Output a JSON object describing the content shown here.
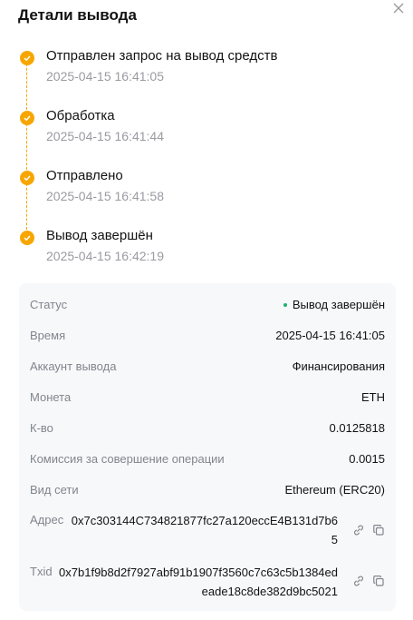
{
  "dialog": {
    "title": "Детали вывода"
  },
  "steps": [
    {
      "label": "Отправлен запрос на вывод средств",
      "time": "2025-04-15 16:41:05"
    },
    {
      "label": "Обработка",
      "time": "2025-04-15 16:41:44"
    },
    {
      "label": "Отправлено",
      "time": "2025-04-15 16:41:58"
    },
    {
      "label": "Вывод завершён",
      "time": "2025-04-15 16:42:19"
    }
  ],
  "details": {
    "status": {
      "label": "Статус",
      "value": "Вывод завершён"
    },
    "time": {
      "label": "Время",
      "value": "2025-04-15 16:41:05"
    },
    "account": {
      "label": "Аккаунт вывода",
      "value": "Финансирования"
    },
    "coin": {
      "label": "Монета",
      "value": "ETH"
    },
    "amount": {
      "label": "К-во",
      "value": "0.0125818"
    },
    "fee": {
      "label": "Комиссия за совершение операции",
      "value": "0.0015"
    },
    "network": {
      "label": "Вид сети",
      "value": "Ethereum (ERC20)"
    },
    "address": {
      "label": "Адрес",
      "value": "0x7c303144C734821877fc27a120eccE4B131d7b65"
    },
    "txid": {
      "label": "Txid",
      "value": "0x7b1f9b8d2f7927abf91b1907f3560c7c63c5b1384edeade18c8de382d9bc5021"
    }
  },
  "colors": {
    "accent": "#f7a600",
    "status_green": "#20b26c",
    "card_bg": "#f7f8fa",
    "muted": "#81858c"
  },
  "icons": [
    "close-icon",
    "check-icon",
    "link-icon",
    "copy-icon"
  ]
}
